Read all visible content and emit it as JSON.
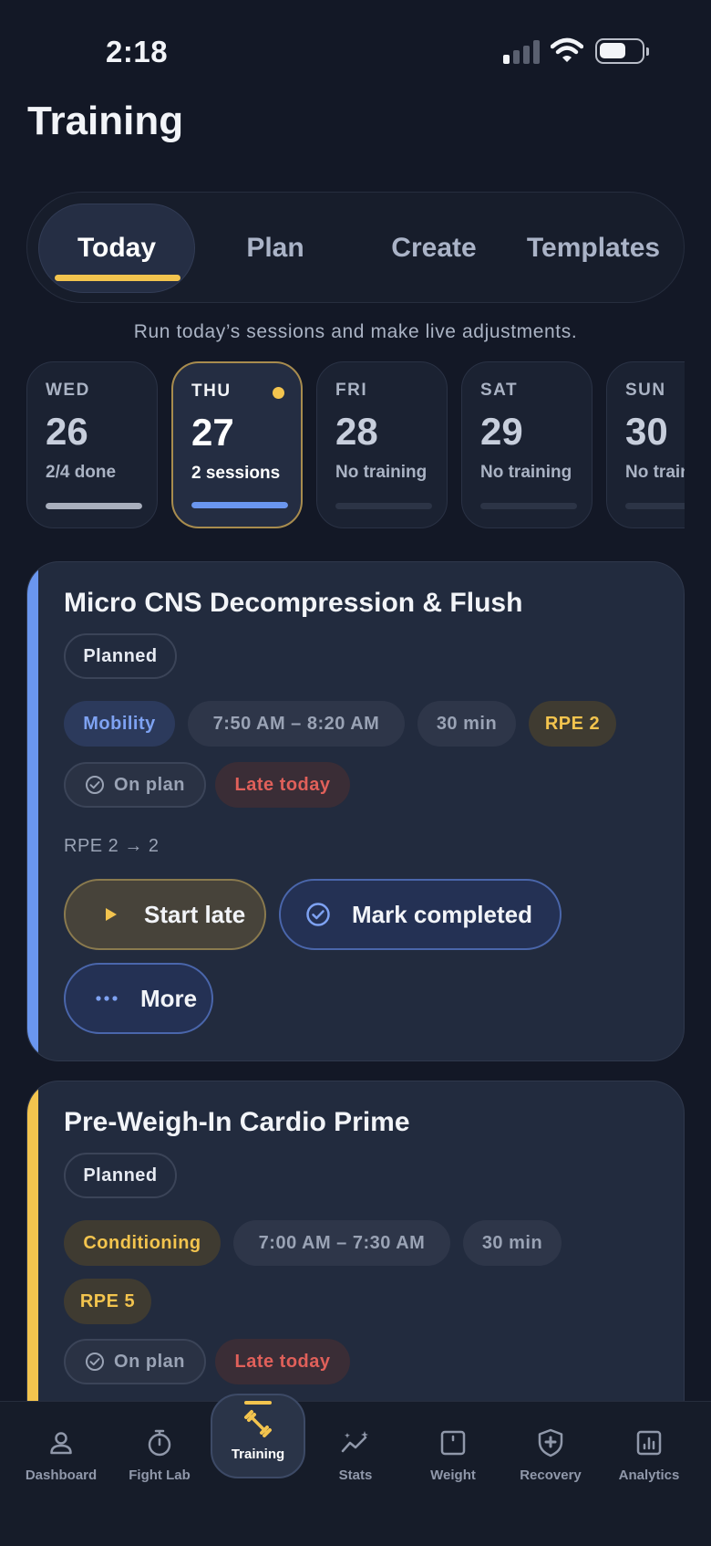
{
  "status_bar": {
    "time": "2:18"
  },
  "page": {
    "title": "Training",
    "subtitle": "Run today’s sessions and make live adjustments."
  },
  "tabs": [
    {
      "label": "Today",
      "active": true
    },
    {
      "label": "Plan",
      "active": false
    },
    {
      "label": "Create",
      "active": false
    },
    {
      "label": "Templates",
      "active": false
    }
  ],
  "days": [
    {
      "dow": "WED",
      "date": "26",
      "status": "2/4 done",
      "progress": 1.0
    },
    {
      "dow": "THU",
      "date": "27",
      "status": "2 sessions",
      "progress": 1.0,
      "selected": true,
      "has_dot": true
    },
    {
      "dow": "FRI",
      "date": "28",
      "status": "No training",
      "progress": 0
    },
    {
      "dow": "SAT",
      "date": "29",
      "status": "No training",
      "progress": 0
    },
    {
      "dow": "SUN",
      "date": "30",
      "status": "No training",
      "progress": 0
    }
  ],
  "sessions": [
    {
      "title": "Micro CNS Decompression & Flush",
      "state": "Planned",
      "category": "Mobility",
      "time": "7:50 AM – 8:20 AM",
      "duration": "30 min",
      "rpe": "RPE 2",
      "plan_status": "On plan",
      "timing": "Late today",
      "rpe_change": "RPE 2 → 2",
      "actions": {
        "start": "Start late",
        "complete": "Mark completed",
        "more": "More"
      },
      "accent": "#6a96ef"
    },
    {
      "title": "Pre-Weigh-In Cardio Prime",
      "state": "Planned",
      "category": "Conditioning",
      "time": "7:00 AM – 7:30 AM",
      "duration": "30 min",
      "rpe": "RPE 5",
      "plan_status": "On plan",
      "timing": "Late today",
      "accent": "#f3c44e"
    }
  ],
  "nav": [
    {
      "label": "Dashboard",
      "icon": "person-icon"
    },
    {
      "label": "Fight Lab",
      "icon": "stopwatch-icon"
    },
    {
      "label": "Training",
      "icon": "dumbbell-icon",
      "active": true
    },
    {
      "label": "Stats",
      "icon": "trend-sparkle-icon"
    },
    {
      "label": "Weight",
      "icon": "scale-icon"
    },
    {
      "label": "Recovery",
      "icon": "shield-plus-icon"
    },
    {
      "label": "Analytics",
      "icon": "bar-chart-icon"
    }
  ],
  "colors": {
    "background": "#131826",
    "accent_amber": "#f3c44e",
    "accent_blue": "#6a96ef",
    "danger": "#e0605a"
  }
}
